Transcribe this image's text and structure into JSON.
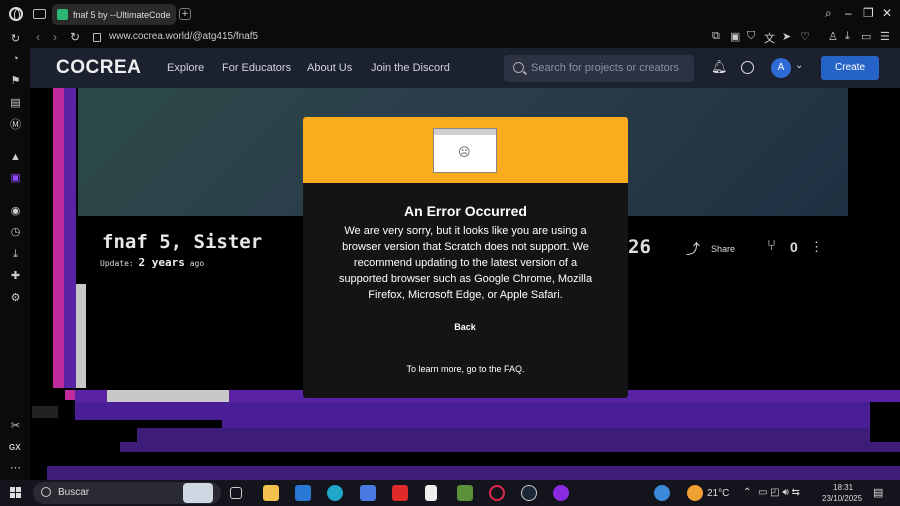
{
  "browser": {
    "tab_title": "fnaf 5 by --UltimateCode",
    "url": "www.cocrea.world/@atg415/fnaf5"
  },
  "site": {
    "brand": "COCREA",
    "nav": [
      "Explore",
      "For Educators",
      "About Us",
      "Join the Discord"
    ],
    "search_placeholder": "Search for projects or creators",
    "avatar_letter": "A",
    "create_label": "Create"
  },
  "project": {
    "title": "fnaf 5, Sister",
    "update_label": "Update:",
    "update_value": "2 years",
    "update_suffix": "ago",
    "count": "26",
    "share_label": "Share",
    "fork_count": "0"
  },
  "modal": {
    "title": "An Error Occurred",
    "message": "We are very sorry, but it looks like you are using a browser version that Scratch does not support. We recommend updating to the latest version of a supported browser such as Google Chrome, Mozilla Firefox, Microsoft Edge, or Apple Safari.",
    "back_label": "Back",
    "faq_text": "To learn more, go to the FAQ."
  },
  "taskbar": {
    "search_label": "Buscar",
    "weather": "21°C",
    "time": "18:31",
    "date": "23/10/2025"
  },
  "sidebar": {
    "gx_label": "GX"
  },
  "colors": {
    "accent": "#fbab1e",
    "create": "#2563c9",
    "nav_bg": "#1c2130"
  }
}
